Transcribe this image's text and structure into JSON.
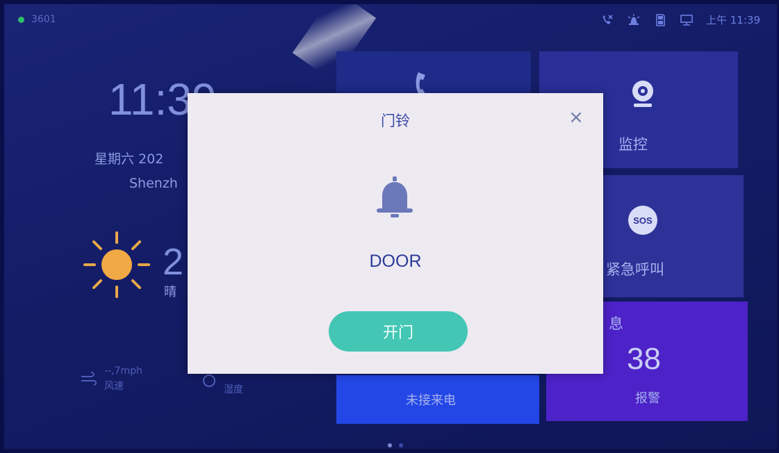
{
  "status_bar": {
    "left_text": "3601",
    "time": "上午 11:39",
    "icons": [
      "missed-call-icon",
      "alarm-icon",
      "sd-card-icon",
      "network-icon"
    ]
  },
  "home": {
    "clock": "11:39",
    "date": "星期六 202",
    "city": "Shenzh",
    "temperature": "2",
    "weather": "晴",
    "wind_value": "--,7mph",
    "wind_label": "风速",
    "humidity_label": "湿度"
  },
  "tiles": {
    "monitor_label": "监控",
    "sos_badge": "SOS",
    "sos_label": "紧急呼叫",
    "message_label": "息",
    "message_count": "38",
    "alarm_label": "报警",
    "missed_call_label": "未接来电"
  },
  "modal": {
    "title": "门铃",
    "close_symbol": "×",
    "device_name": "DOOR",
    "open_button": "开门"
  },
  "colors": {
    "accent_teal": "#43c6b4",
    "message_tile": "#4d22c8",
    "missed_tile": "#2347e6"
  }
}
